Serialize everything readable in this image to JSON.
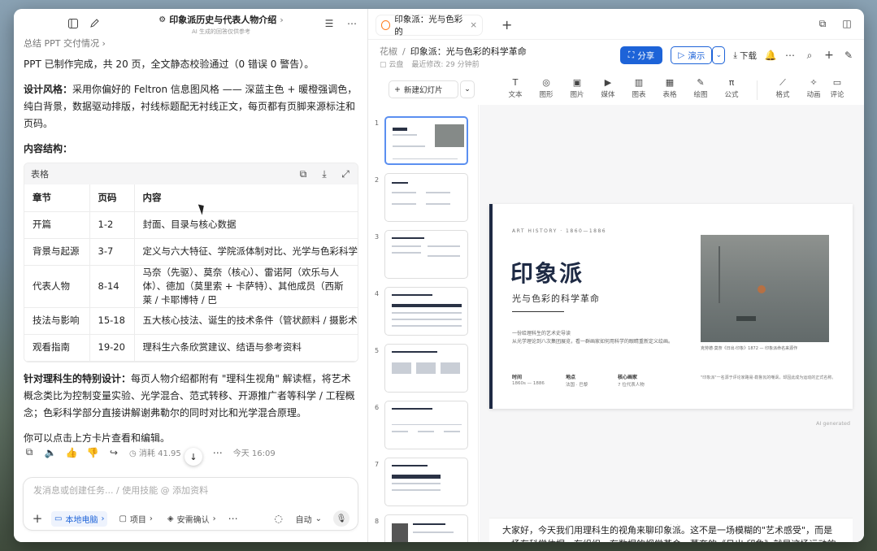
{
  "chat": {
    "title": "印象派历史与代表人物介绍",
    "subtitle": "AI 生成的回答仅供参考",
    "prev_link": "总结 PPT 交付情况",
    "intro": "PPT 已制作完成，共 20 页，全文静态校验通过（0 错误 0 警告）。",
    "style_label": "设计风格：",
    "style_text": "采用你偏好的 Feltron 信息图风格 —— 深蓝主色 + 暖橙强调色，纯白背景，数据驱动排版，衬线标题配无衬线正文，每页都有页脚来源标注和页码。",
    "structure_label": "内容结构：",
    "table_label": "表格",
    "table": {
      "headers": [
        "章节",
        "页码",
        "内容"
      ],
      "rows": [
        [
          "开篇",
          "1-2",
          "封面、目录与核心数据"
        ],
        [
          "背景与起源",
          "3-7",
          "定义与六大特征、学院派体制对比、光学与色彩科学（"
        ],
        [
          "代表人物",
          "8-14",
          "马奈（先驱）、莫奈（核心）、雷诺阿（欢乐与人体）、德加（莫里索 + 卡萨特）、其他成员（西斯莱 / 卡耶博特 / 巴"
        ],
        [
          "技法与影响",
          "15-18",
          "五大核心技法、诞生的技术条件（管状颜料 / 摄影术 / 铁"
        ],
        [
          "观看指南",
          "19-20",
          "理科生六条欣赏建议、结语与参考资料"
        ]
      ]
    },
    "sci_label": "针对理科生的特别设计：",
    "sci_text": "每页人物介绍都附有 \"理科生视角\" 解读框，将艺术概念类比为控制变量实验、光学混合、范式转移、开源推广者等科学 / 工程概念；色彩科学部分直接讲解谢弗勒尔的同时对比和光学混合原理。",
    "closing": "你可以点击上方卡片查看和编辑。",
    "tokens": "消耗 41.95",
    "time": "今天 16:09",
    "composer": {
      "placeholder": "发消息或创建任务... / 使用技能 @ 添加资料",
      "local": "本地电脑",
      "project": "项目",
      "confirm": "安需确认",
      "auto": "自动"
    }
  },
  "editor": {
    "tab_title": "印象派：光与色彩的",
    "breadcrumb_root": "花椒",
    "doc_title": "印象派：光与色彩的科学革命",
    "location": "云盘",
    "modified": "最近修改: 29 分钟前",
    "share": "分享",
    "present": "演示",
    "download": "下载",
    "new_slide": "新建幻灯片",
    "tools": [
      "文本",
      "图形",
      "图片",
      "媒体",
      "图表",
      "表格",
      "绘图",
      "公式",
      "格式",
      "动画",
      "评论"
    ],
    "slide_numbers": [
      "1",
      "2",
      "3",
      "4",
      "5",
      "6",
      "7",
      "8"
    ],
    "slide": {
      "kicker": "ART HISTORY · 1860—1886",
      "title": "印象派",
      "subtitle": "光与色彩的科学革命",
      "desc1": "一份给理科生的艺术史导读",
      "desc2": "从光学理论到八次集团展览，看一群画家如何用科学的眼睛重新定义绘画。",
      "caption": "克劳德·莫奈《日出·印象》1872 — 印象派命名来源作",
      "labels": [
        "时间",
        "地点",
        "核心画家"
      ],
      "values": [
        "1860s — 1886",
        "法国 · 巴黎",
        "7 位代表人物"
      ],
      "note": "\"印象派\"一名源于评论家路易·勒鲁瓦的嘲讽，却因此成为运动的正式名称。"
    },
    "ai_generated": "AI generated",
    "notes": "大家好，今天我们用理科生的视角来聊印象派。这不是一场模糊的\"艺术感受\"，而是一场有科学依据、有组织、有数据的视觉革命。莫奈的《日出·印象》就是这场运动的命名来源——一个嘲"
  }
}
